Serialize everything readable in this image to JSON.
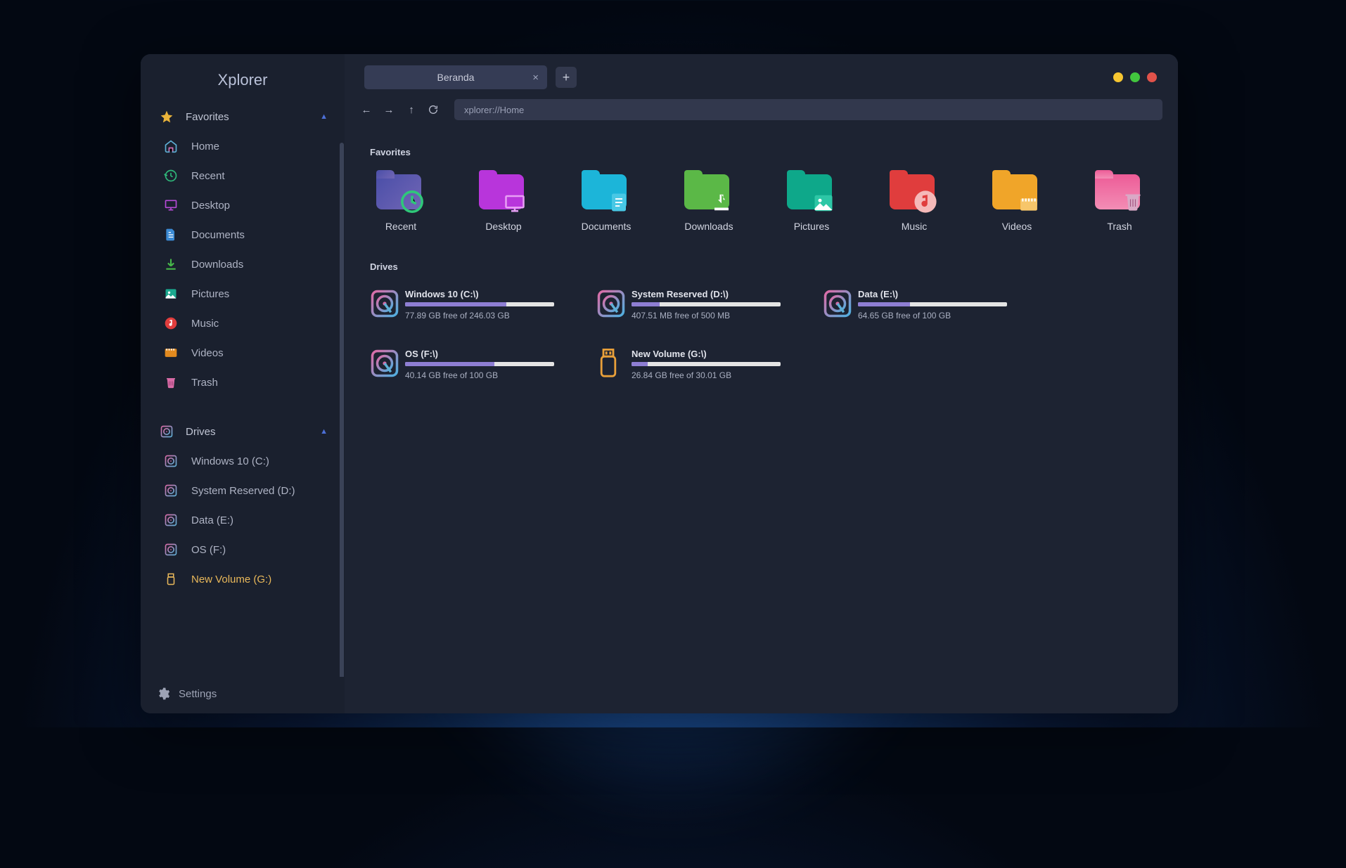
{
  "app_title": "Xplorer",
  "tab": {
    "label": "Beranda"
  },
  "address_bar": "xplorer://Home",
  "sidebar": {
    "favorites_label": "Favorites",
    "drives_label": "Drives",
    "items": [
      {
        "label": "Home"
      },
      {
        "label": "Recent"
      },
      {
        "label": "Desktop"
      },
      {
        "label": "Documents"
      },
      {
        "label": "Downloads"
      },
      {
        "label": "Pictures"
      },
      {
        "label": "Music"
      },
      {
        "label": "Videos"
      },
      {
        "label": "Trash"
      }
    ],
    "drive_items": [
      {
        "label": "Windows 10 (C:)"
      },
      {
        "label": "System Reserved (D:)"
      },
      {
        "label": "Data (E:)"
      },
      {
        "label": "OS (F:)"
      },
      {
        "label": "New Volume (G:)"
      }
    ]
  },
  "settings_label": "Settings",
  "sections": {
    "favorites": "Favorites",
    "drives": "Drives"
  },
  "favorites": [
    {
      "label": "Recent"
    },
    {
      "label": "Desktop"
    },
    {
      "label": "Documents"
    },
    {
      "label": "Downloads"
    },
    {
      "label": "Pictures"
    },
    {
      "label": "Music"
    },
    {
      "label": "Videos"
    },
    {
      "label": "Trash"
    }
  ],
  "drives": [
    {
      "name": "Windows 10 (C:\\)",
      "free": "77.89 GB free of 246.03 GB",
      "pct": 68
    },
    {
      "name": "System Reserved (D:\\)",
      "free": "407.51 MB free of 500 MB",
      "pct": 19
    },
    {
      "name": "Data (E:\\)",
      "free": "64.65 GB free of 100 GB",
      "pct": 35
    },
    {
      "name": "OS (F:\\)",
      "free": "40.14 GB free of 100 GB",
      "pct": 60
    },
    {
      "name": "New Volume (G:\\)",
      "free": "26.84 GB free of 30.01 GB",
      "pct": 11
    }
  ]
}
